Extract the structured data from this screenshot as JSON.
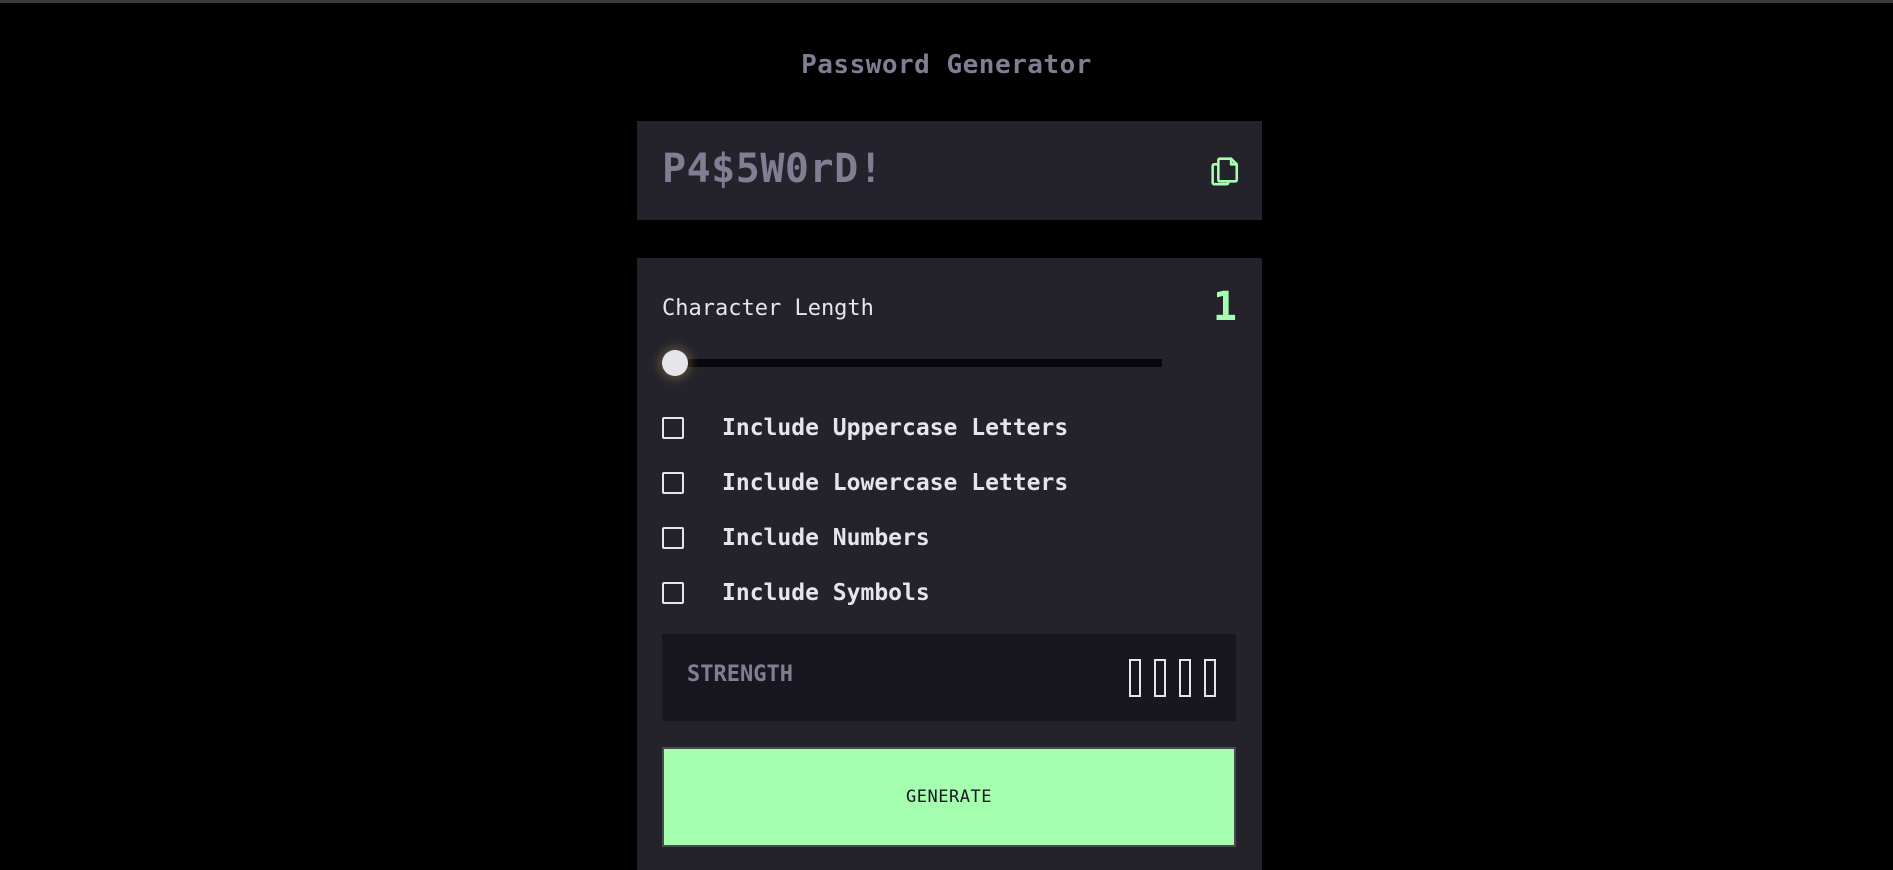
{
  "app": {
    "title": "Password Generator"
  },
  "password": {
    "value": "P4$5W0rD!",
    "copy_icon": "copy-icon"
  },
  "length": {
    "label": "Character Length",
    "value": "1",
    "min": 1,
    "max": 20
  },
  "options": [
    {
      "label": "Include Uppercase Letters",
      "checked": false
    },
    {
      "label": "Include Lowercase Letters",
      "checked": false
    },
    {
      "label": "Include Numbers",
      "checked": false
    },
    {
      "label": "Include Symbols",
      "checked": false
    }
  ],
  "strength": {
    "label": "STRENGTH",
    "level": 0,
    "bars": 4
  },
  "generate": {
    "label": "GENERATE"
  },
  "colors": {
    "background": "#000000",
    "panel": "#24232C",
    "accent": "#A4FFAF",
    "muted": "#817D92",
    "text": "#E6E5EA"
  }
}
